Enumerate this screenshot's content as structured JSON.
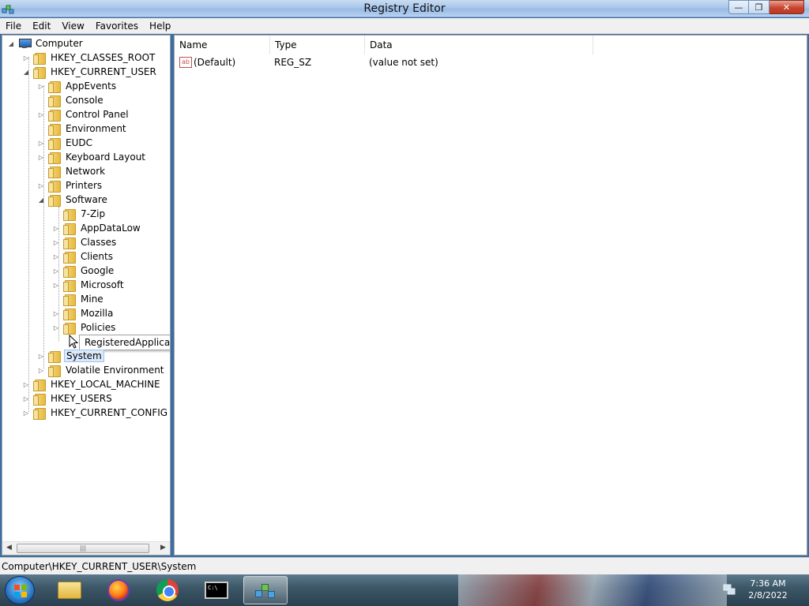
{
  "window": {
    "title": "Registry Editor",
    "buttons": {
      "minimize": "—",
      "maximize": "❐",
      "close": "✕"
    }
  },
  "menu": [
    "File",
    "Edit",
    "View",
    "Favorites",
    "Help"
  ],
  "tree": {
    "root": "Computer",
    "hives": {
      "classes_root": "HKEY_CLASSES_ROOT",
      "current_user": "HKEY_CURRENT_USER",
      "local_machine": "HKEY_LOCAL_MACHINE",
      "users": "HKEY_USERS",
      "current_config": "HKEY_CURRENT_CONFIG"
    },
    "current_user_children": [
      "AppEvents",
      "Console",
      "Control Panel",
      "Environment",
      "EUDC",
      "Keyboard Layout",
      "Network",
      "Printers",
      "Software",
      "System",
      "Volatile Environment"
    ],
    "software_children": [
      "7-Zip",
      "AppDataLow",
      "Classes",
      "Clients",
      "Google",
      "Microsoft",
      "Mine",
      "Mozilla",
      "Policies"
    ],
    "tooltip": "RegisteredApplication",
    "selected": "System"
  },
  "list": {
    "columns": [
      "Name",
      "Type",
      "Data"
    ],
    "rows": [
      {
        "icon": "ab",
        "name": "(Default)",
        "type": "REG_SZ",
        "data": "(value not set)"
      }
    ]
  },
  "statusbar": {
    "path": "Computer\\HKEY_CURRENT_USER\\System"
  },
  "taskbar": {
    "clock_time": "7:36 AM",
    "clock_date": "2/8/2022",
    "cmd_label": "C:\\"
  }
}
